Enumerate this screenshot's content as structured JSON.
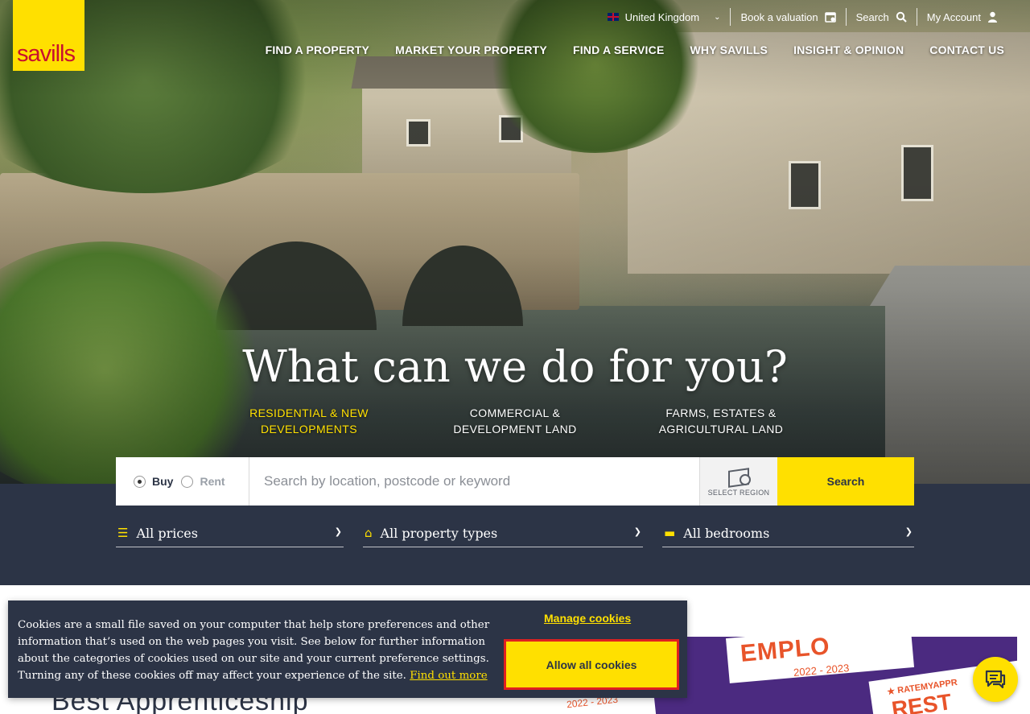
{
  "brand": {
    "logo_text": "savills",
    "primary_color": "#ffe000",
    "dark_color": "#2c3446",
    "logo_text_color": "#c8102e"
  },
  "utility_nav": {
    "country": "United Kingdom",
    "valuation": "Book a valuation",
    "search": "Search",
    "account": "My Account"
  },
  "main_nav": [
    "FIND A PROPERTY",
    "MARKET YOUR PROPERTY",
    "FIND A SERVICE",
    "WHY SAVILLS",
    "INSIGHT & OPINION",
    "CONTACT US"
  ],
  "hero": {
    "headline": "What can we do for you?",
    "sectors": [
      {
        "line1": "RESIDENTIAL & NEW",
        "line2": "DEVELOPMENTS",
        "active": true
      },
      {
        "line1": "COMMERCIAL &",
        "line2": "DEVELOPMENT LAND",
        "active": false
      },
      {
        "line1": "FARMS, ESTATES &",
        "line2": "AGRICULTURAL LAND",
        "active": false
      }
    ]
  },
  "search": {
    "buy_label": "Buy",
    "rent_label": "Rent",
    "selected": "Buy",
    "placeholder": "Search by location, postcode or keyword",
    "region_label": "SELECT REGION",
    "button": "Search"
  },
  "filters": {
    "price": "All prices",
    "property_type": "All property types",
    "bedrooms": "All bedrooms"
  },
  "lower": {
    "heading": "Best Apprenticeship",
    "promo_texts": [
      "EMPLO",
      "2022 - 2023",
      "★ RATEMYAPPR",
      "REST",
      "2022 - 2023"
    ]
  },
  "cookie_banner": {
    "text": "Cookies are a small file saved on your computer that help store preferences and other information that’s used on the web pages you visit. See below for further information about the categories of cookies used on our site and your current preference settings. Turning any of these cookies off may affect your experience of the site.",
    "find_out_more": "Find out more",
    "manage": "Manage cookies",
    "allow_all": "Allow all cookies"
  }
}
